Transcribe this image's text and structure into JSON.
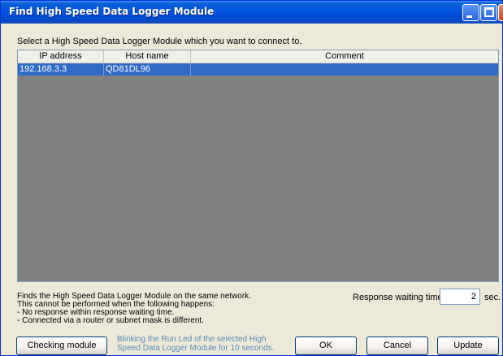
{
  "window": {
    "title": "Find High Speed Data Logger Module"
  },
  "prompt": "Select a High Speed Data Logger Module which you want to connect to.",
  "table": {
    "columns": [
      "IP address",
      "Host name",
      "Comment"
    ],
    "rows": [
      {
        "ip": "192.168.3.3",
        "host": "QD81DL96",
        "comment": "",
        "selected": true
      }
    ]
  },
  "info_lines": [
    "Finds the High Speed Data Logger Module on the same network.",
    "This cannot be performed when the following happens:",
    "- No response within response waiting time.",
    "- Connected via a router or subnet mask is different."
  ],
  "response": {
    "label": "Response waiting time",
    "value": "2",
    "unit": "sec."
  },
  "buttons": {
    "checking": "Checking module",
    "ok": "OK",
    "cancel": "Cancel",
    "update": "Update"
  },
  "blink_note": {
    "line1": "Blinking the Run Led of the selected High",
    "line2": "Speed Data Logger Module for 10 seconds."
  },
  "colors": {
    "selection": "#316ac5",
    "list_background": "#808080",
    "note_text": "#5b8bb5"
  }
}
